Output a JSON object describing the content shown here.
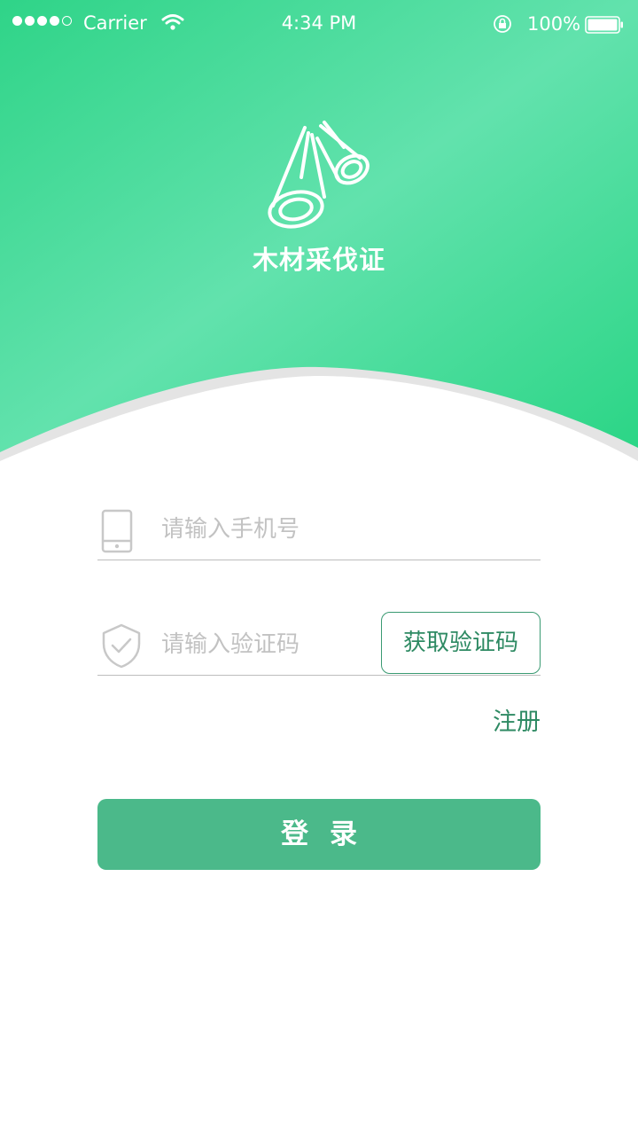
{
  "status_bar": {
    "carrier": "Carrier",
    "time": "4:34 PM",
    "battery": "100%",
    "icons": [
      "signal-dots",
      "wifi-icon",
      "rotation-lock-icon",
      "battery-icon"
    ]
  },
  "app": {
    "title": "木材采伐证",
    "logo_icon": "logs-icon"
  },
  "form": {
    "phone": {
      "placeholder": "请输入手机号",
      "value": "",
      "icon": "phone-icon"
    },
    "code": {
      "placeholder": "请输入验证码",
      "value": "",
      "icon": "shield-check-icon",
      "get_code_label": "获取验证码"
    },
    "register_label": "注册",
    "login_label": "登录"
  },
  "colors": {
    "header_gradient_start": "#2fd488",
    "header_gradient_mid": "#62e2ad",
    "header_gradient_end": "#2ad585",
    "accent": "#2e8a63",
    "login_button": "#4bb98a",
    "placeholder": "#c2c2c2",
    "divider": "#bdbdbd"
  }
}
